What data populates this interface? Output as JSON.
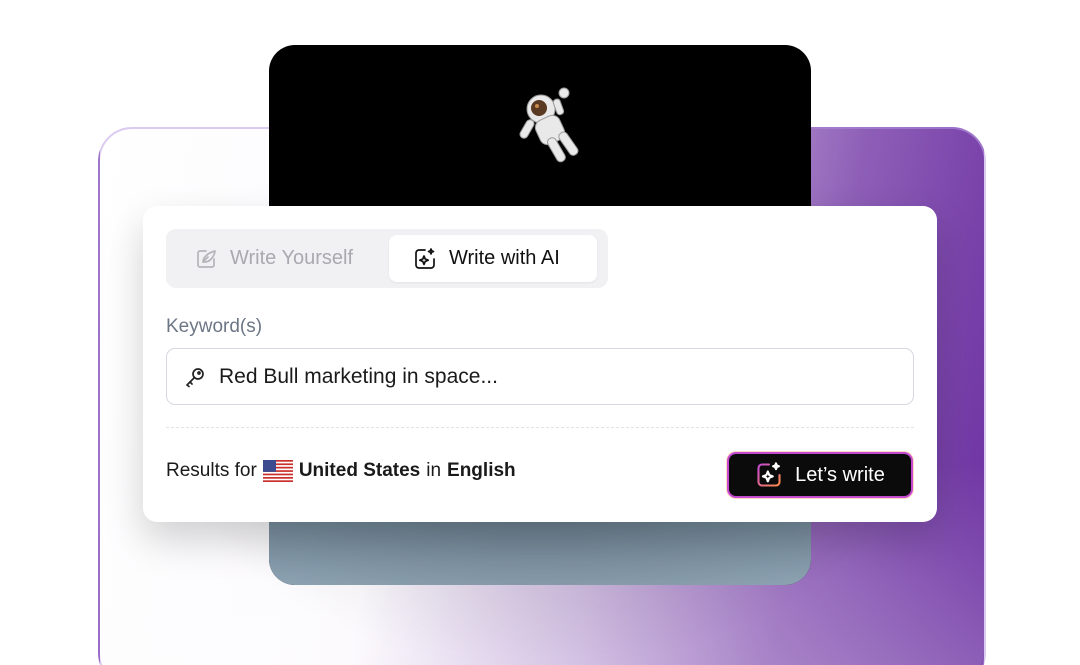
{
  "tabs": [
    {
      "label": "Write Yourself",
      "icon": "pen-icon",
      "active": false
    },
    {
      "label": "Write with AI",
      "icon": "sparkle-icon",
      "active": true
    }
  ],
  "keyword": {
    "label": "Keyword(s)",
    "value": "Red Bull marketing in space...",
    "icon": "key-icon"
  },
  "results": {
    "prefix": "Results for",
    "country": "United States",
    "connector": "in",
    "language": "English",
    "flag_icon": "us-flag-icon"
  },
  "cta": {
    "label": "Let’s write",
    "icon": "sparkle-icon"
  },
  "colors": {
    "accent_gradient_start": "#c64ad0",
    "accent_gradient_end": "#ff8a4c",
    "bg_purple": "#6a2ea1"
  }
}
